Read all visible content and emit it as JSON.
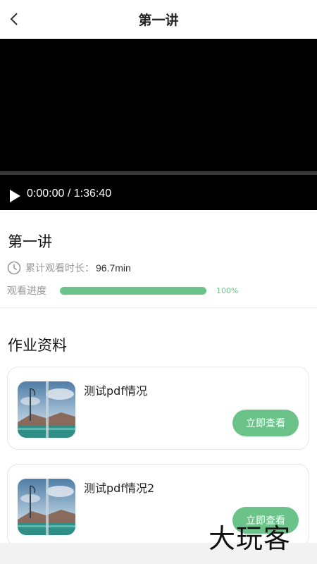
{
  "header": {
    "title": "第一讲",
    "back_icon": "back-arrow-icon"
  },
  "player": {
    "time": "0:00:00 / 1:36:40",
    "play_icon": "play-icon"
  },
  "lesson": {
    "title": "第一讲",
    "watch_label": "累计观看时长：",
    "watch_value": "96.7min",
    "progress_label": "观看进度",
    "progress_value": 1.0,
    "progress_text": "100%"
  },
  "materials": {
    "section_title": "作业资料",
    "items": [
      {
        "title": "测试pdf情况",
        "button": "立即查看"
      },
      {
        "title": "测试pdf情况2",
        "button": "立即查看"
      }
    ]
  },
  "watermark": "大玩客",
  "colors": {
    "accent": "#6cc38a",
    "player_bg": "#000000"
  }
}
